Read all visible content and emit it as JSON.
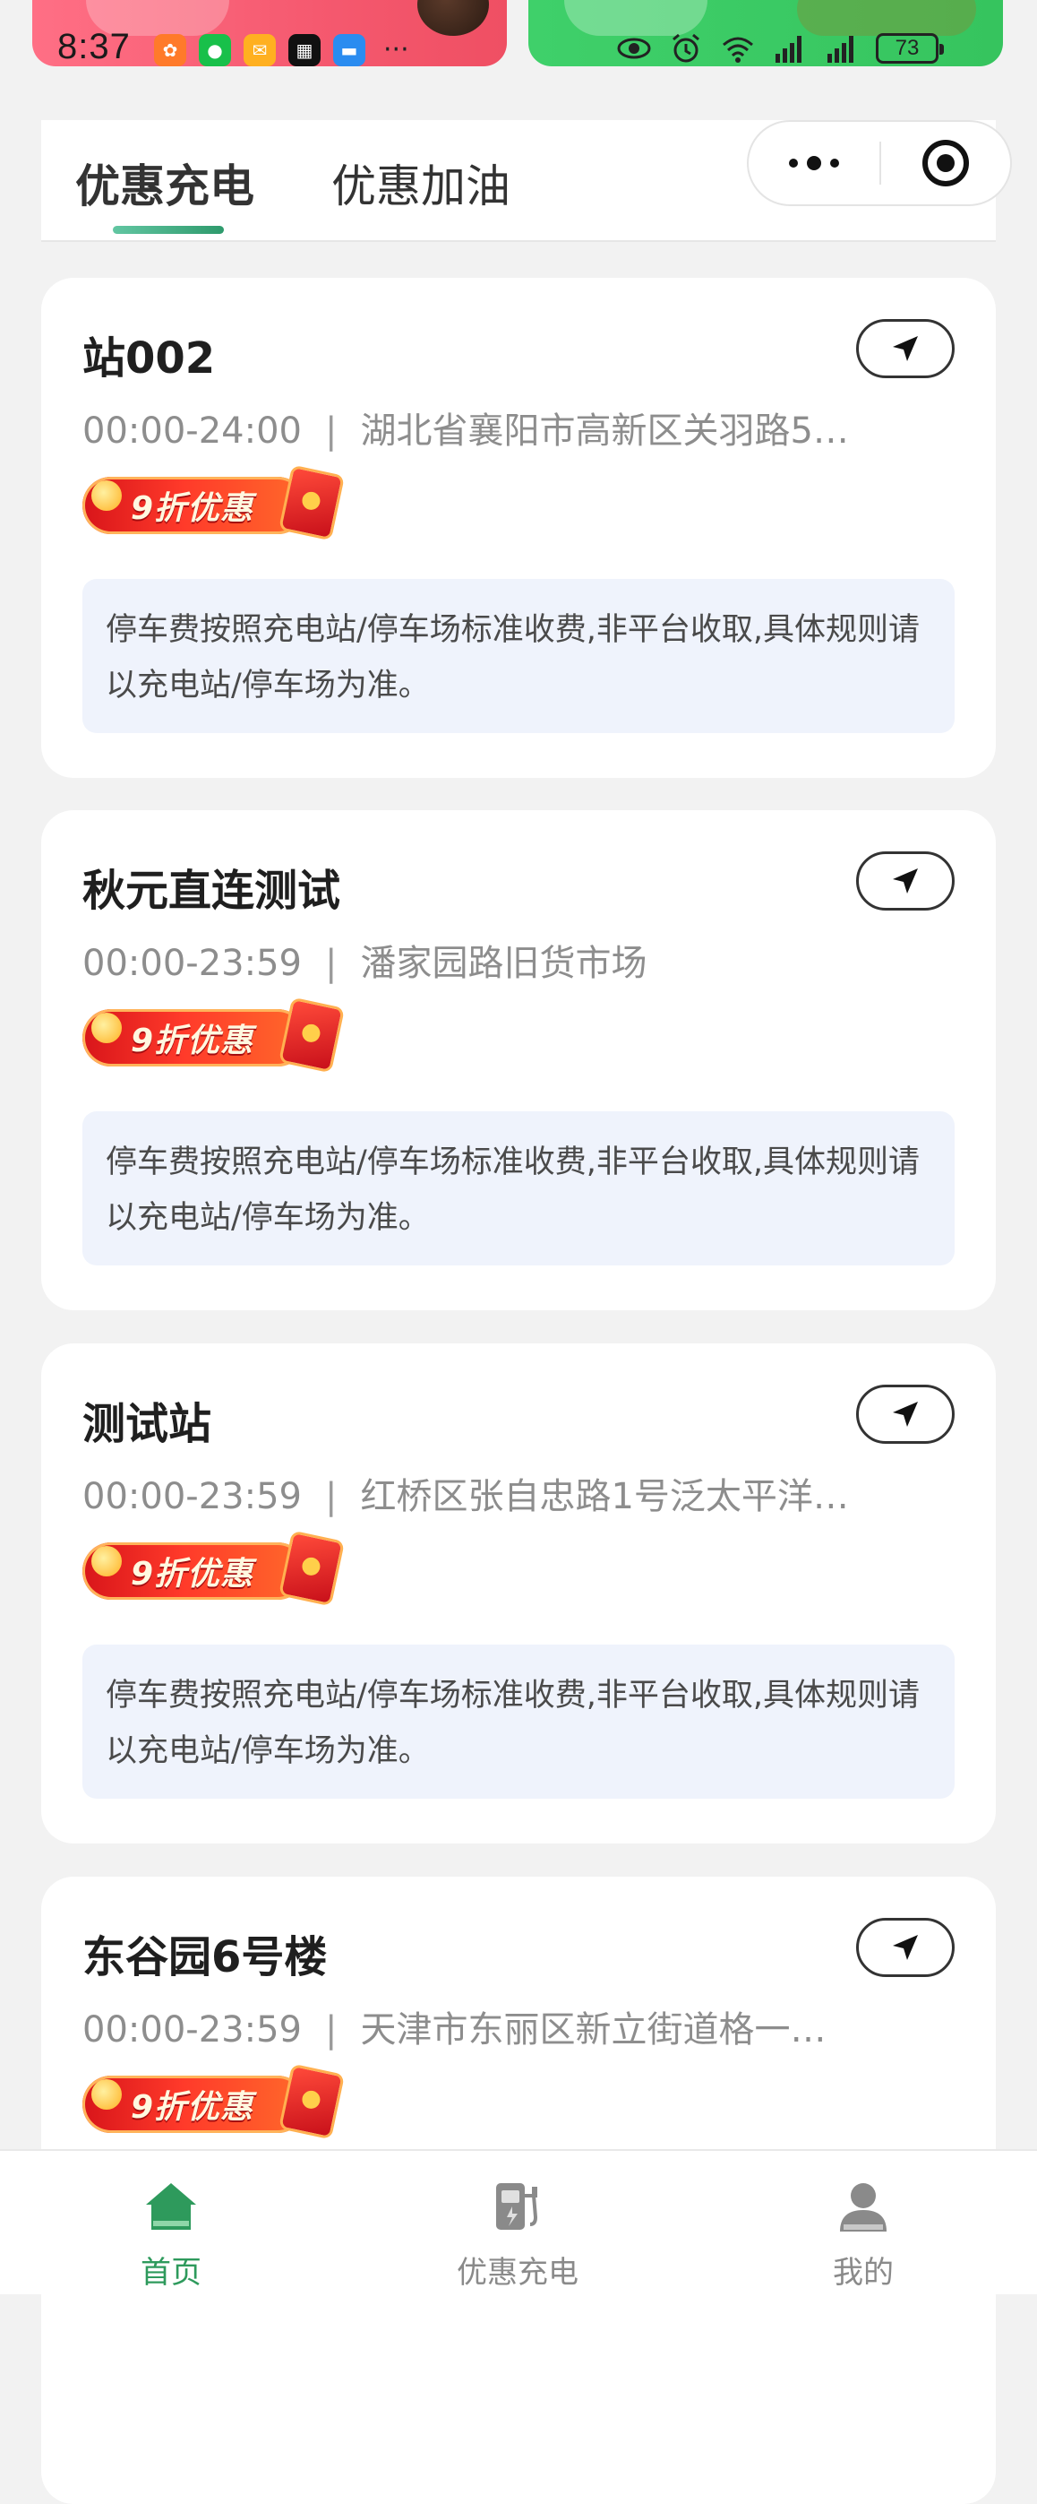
{
  "status_bar": {
    "time": "8:37",
    "more": "···",
    "battery": "73"
  },
  "tabs": [
    {
      "label": "优惠充电",
      "active": true
    },
    {
      "label": "优惠加油",
      "active": false
    }
  ],
  "stations": [
    {
      "name": "站002",
      "hours": "00:00-24:00",
      "address": "湖北省襄阳市高新区关羽路5…",
      "badge": "9折优惠",
      "notice": "停车费按照充电站/停车场标准收费,非平台收取,具体规则请以充电站/停车场为准。"
    },
    {
      "name": "秋元直连测试",
      "hours": "00:00-23:59",
      "address": "潘家园路旧货市场",
      "badge": "9折优惠",
      "notice": "停车费按照充电站/停车场标准收费,非平台收取,具体规则请以充电站/停车场为准。"
    },
    {
      "name": "测试站",
      "hours": "00:00-23:59",
      "address": "红桥区张自忠路1号泛太平洋…",
      "badge": "9折优惠",
      "notice": "停车费按照充电站/停车场标准收费,非平台收取,具体规则请以充电站/停车场为准。"
    },
    {
      "name": "东谷园6号楼",
      "hours": "00:00-23:59",
      "address": "天津市东丽区新立街道格一…",
      "badge": "9折优惠"
    }
  ],
  "separator": "|",
  "bottom_nav": [
    {
      "label": "首页",
      "icon": "home-icon",
      "active": true
    },
    {
      "label": "优惠充电",
      "icon": "charging-pile-icon",
      "active": false
    },
    {
      "label": "我的",
      "icon": "user-icon",
      "active": false
    }
  ],
  "colors": {
    "accent": "#2e9a5c",
    "notice_bg": "#eff3fc",
    "page_bg": "#f2f2f2",
    "badge_red": "#e8211e"
  }
}
